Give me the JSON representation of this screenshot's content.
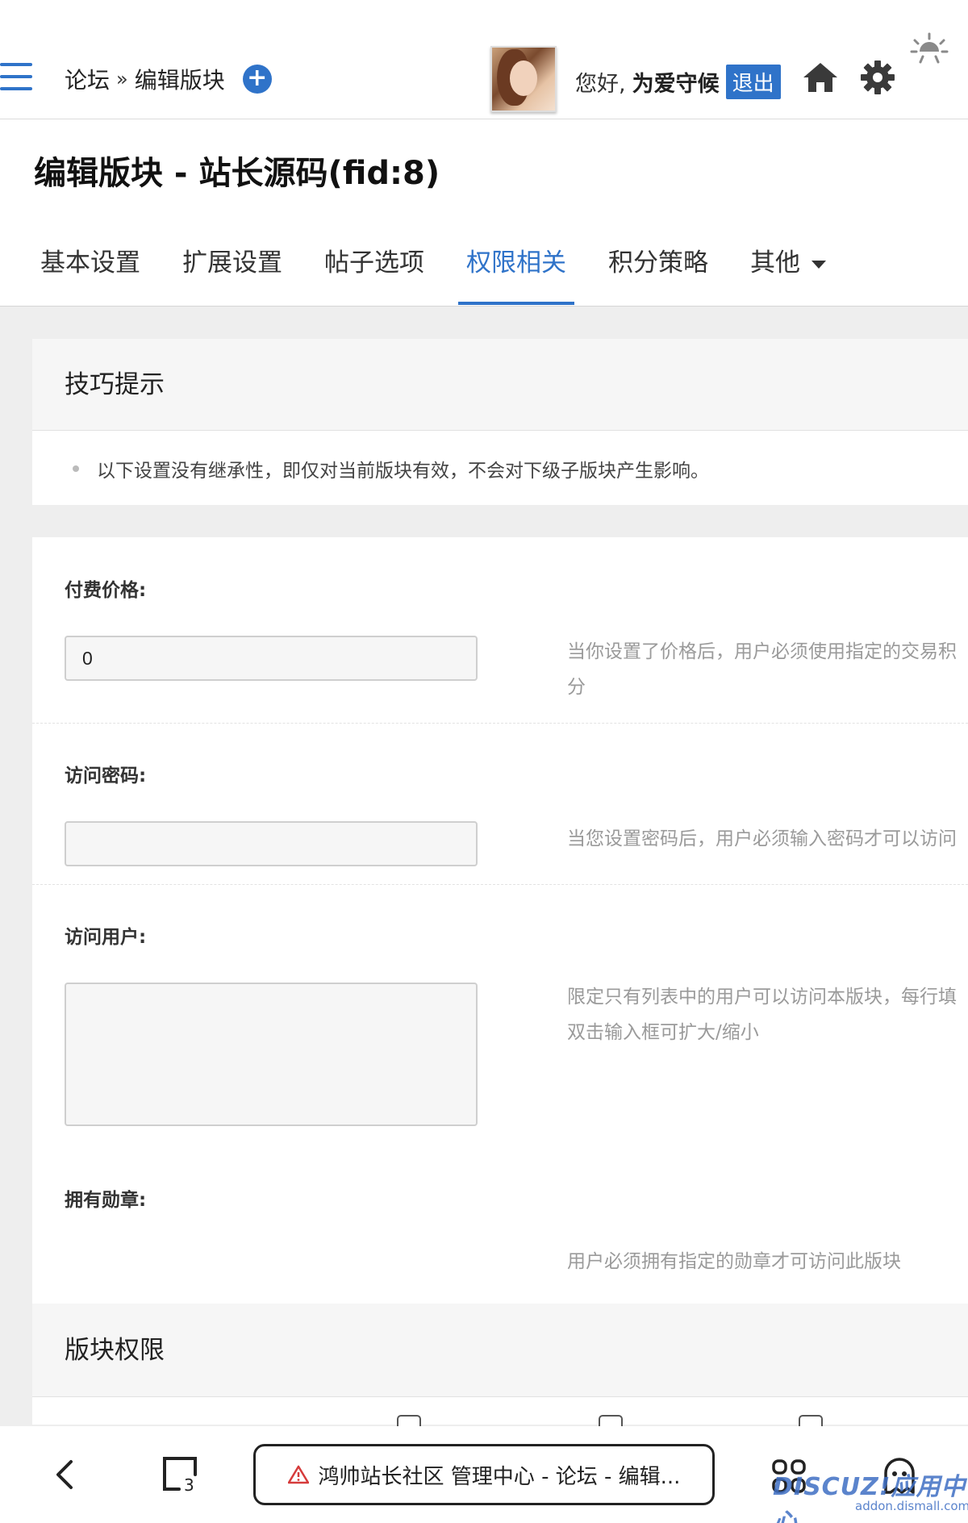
{
  "header": {
    "breadcrumb_root": "论坛",
    "breadcrumb_sep": "»",
    "breadcrumb_current": "编辑版块",
    "greeting": "您好,",
    "username": "为爱守候",
    "logout_label": "退出"
  },
  "page": {
    "title": "编辑版块 - 站长源码(fid:8)"
  },
  "tabs": [
    {
      "label": "基本设置"
    },
    {
      "label": "扩展设置"
    },
    {
      "label": "帖子选项"
    },
    {
      "label": "权限相关",
      "active": true
    },
    {
      "label": "积分策略"
    },
    {
      "label": "其他"
    }
  ],
  "tips": {
    "title": "技巧提示",
    "text": "以下设置没有继承性，即仅对当前版块有效，不会对下级子版块产生影响。"
  },
  "form": {
    "price_label": "付费价格:",
    "price_value": "0",
    "price_hint_1": "当你设置了价格后，用户必须使用指定的交易积",
    "price_hint_2": "分",
    "password_label": "访问密码:",
    "password_value": "",
    "password_hint": "当您设置密码后，用户必须输入密码才可以访问",
    "users_label": "访问用户:",
    "users_value": "",
    "users_hint_1": "限定只有列表中的用户可以访问本版块，每行填",
    "users_hint_2": "双击输入框可扩大/缩小",
    "medals_label": "拥有勋章:",
    "medals_hint": "用户必须拥有指定的勋章才可访问此版块"
  },
  "section": {
    "title": "版块权限"
  },
  "browser": {
    "url_title": "鸿帅站长社区 管理中心 - 论坛 - 编辑...",
    "tab_count": "3"
  },
  "watermark": {
    "brand": "DISCUZ!应用中心",
    "domain": "addon.dismall.com"
  },
  "colors": {
    "accent": "#2f73c9",
    "hint": "#9a9a9a",
    "panel": "#f6f6f6"
  }
}
